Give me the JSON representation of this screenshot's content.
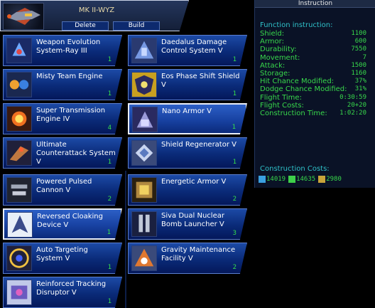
{
  "ship": {
    "name": "MK II-WYZ",
    "delete_label": "Delete",
    "build_label": "Build"
  },
  "components": [
    {
      "name": "Weapon Evolution System-Ray III",
      "count": "1",
      "icon": "weapon-evolution-icon",
      "selected": false
    },
    {
      "name": "Daedalus Damage Control System V",
      "count": "1",
      "icon": "damage-control-icon",
      "selected": false
    },
    {
      "name": "Misty Team Engine",
      "count": "1",
      "icon": "engine-icon",
      "selected": false
    },
    {
      "name": "Eos Phase Shift Shield V",
      "count": "1",
      "icon": "shield-icon",
      "selected": false
    },
    {
      "name": "Super Transmission Engine IV",
      "count": "4",
      "icon": "transmission-engine-icon",
      "selected": false
    },
    {
      "name": "Nano Armor V",
      "count": "1",
      "icon": "armor-icon",
      "selected": true
    },
    {
      "name": "Ultimate Counterattack System V",
      "count": "1",
      "icon": "counterattack-icon",
      "selected": false
    },
    {
      "name": "Shield Regenerator V",
      "count": "1",
      "icon": "shield-regenerator-icon",
      "selected": false
    },
    {
      "name": "Powered Pulsed Cannon V",
      "count": "2",
      "icon": "cannon-icon",
      "selected": false
    },
    {
      "name": "Energetic Armor V",
      "count": "2",
      "icon": "energetic-armor-icon",
      "selected": false
    },
    {
      "name": "Reversed Cloaking Device V",
      "count": "1",
      "icon": "cloaking-icon",
      "selected": true
    },
    {
      "name": "Siva Dual Nuclear Bomb Launcher V",
      "count": "3",
      "icon": "bomb-launcher-icon",
      "selected": false
    },
    {
      "name": "Auto Targeting System V",
      "count": "1",
      "icon": "targeting-icon",
      "selected": false
    },
    {
      "name": "Gravity Maintenance Facility V",
      "count": "2",
      "icon": "gravity-facility-icon",
      "selected": false
    },
    {
      "name": "Reinforced Tracking Disruptor V",
      "count": "1",
      "icon": "tracking-disruptor-icon",
      "selected": false
    }
  ],
  "instruction": {
    "title": "Instruction",
    "function_heading": "Function instruction:",
    "stats": [
      {
        "label": "Shield:",
        "value": "1100"
      },
      {
        "label": "Armor:",
        "value": "600"
      },
      {
        "label": "Durability:",
        "value": "7550"
      },
      {
        "label": "Movement:",
        "value": "7"
      },
      {
        "label": "Attack:",
        "value": "1500"
      },
      {
        "label": "Storage:",
        "value": "1160"
      },
      {
        "label": "Hit Chance Modified:",
        "value": "37%"
      },
      {
        "label": "Dodge Chance Modified:",
        "value": "31%"
      },
      {
        "label": "Flight Time:",
        "value": "0:30:59"
      },
      {
        "label": "Flight Costs:",
        "value": "20+20"
      },
      {
        "label": "Construction Time:",
        "value": "1:02:20"
      }
    ],
    "costs_heading": "Construction Costs:",
    "costs": [
      {
        "resource": "metal-icon",
        "value": "14019",
        "color": "#3aa0e0"
      },
      {
        "resource": "crystal-icon",
        "value": "14635",
        "color": "#3ed04a"
      },
      {
        "resource": "gas-icon",
        "value": "2980",
        "color": "#c9a43a"
      }
    ]
  },
  "colors": {
    "stat_green": "#38d84b",
    "heading_cyan": "#2fc0c8",
    "card_blue": "#0a2a78",
    "ship_name_gold": "#e8d9a8"
  }
}
